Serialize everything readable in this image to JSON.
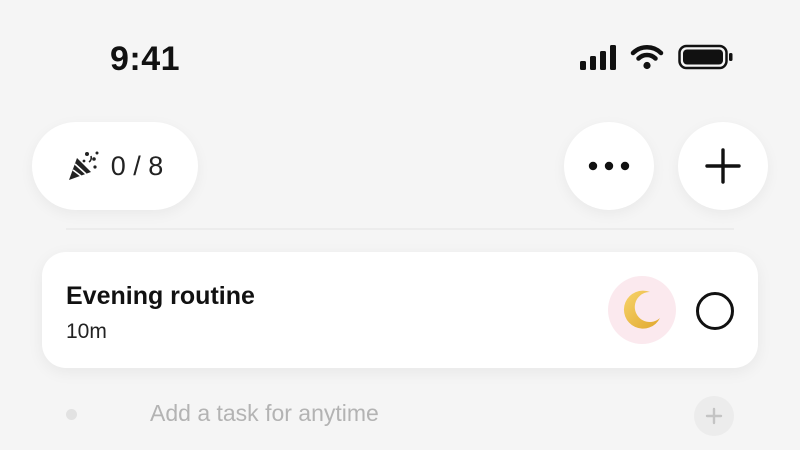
{
  "status_bar": {
    "time": "9:41",
    "icons": [
      "cellular-signal-icon",
      "wifi-icon",
      "battery-icon"
    ]
  },
  "header": {
    "progress": {
      "icon": "party-popper-icon",
      "count": "0 / 8"
    },
    "more_button_icon": "ellipsis-icon",
    "add_button_icon": "plus-icon"
  },
  "tasks": [
    {
      "title": "Evening routine",
      "duration": "10m",
      "icon": "crescent-moon-icon",
      "icon_bg_color": "#fbe9ee",
      "completed": false
    }
  ],
  "add_task": {
    "placeholder": "Add a task for anytime",
    "button_icon": "plus-icon"
  },
  "colors": {
    "background": "#f5f5f5",
    "card": "#ffffff",
    "text": "#111111",
    "placeholder": "#b3b3b3"
  }
}
